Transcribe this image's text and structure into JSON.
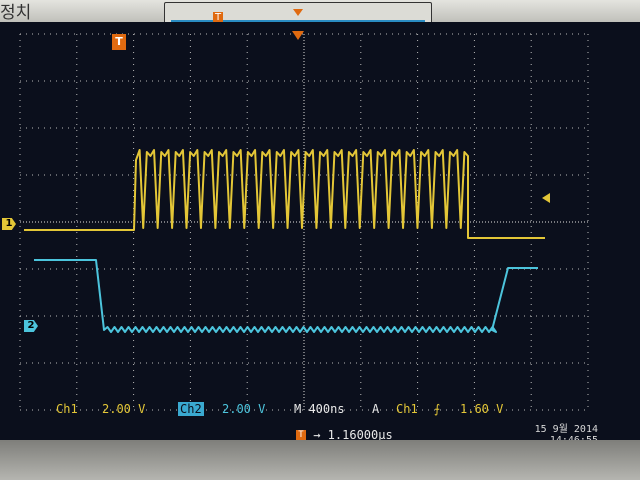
{
  "bezel": {
    "corner_text": "정치"
  },
  "trigger": {
    "marker_label": "T"
  },
  "channels": {
    "ch1_marker": "1",
    "ch2_marker": "2",
    "ch1_color": "#e3c637",
    "ch2_color": "#4cc4dc"
  },
  "status": {
    "ch1_label": "Ch1",
    "ch1_scale": "2.00 V",
    "ch2_label": "Ch2",
    "ch2_scale": "2.00 V",
    "timebase": "M 400ns",
    "trigger_mode": "A",
    "trigger_channel": "Ch1",
    "trigger_edge": "rising-edge-icon",
    "trigger_edge_symbol": "⨍",
    "trigger_level": "1.60 V"
  },
  "horizontal_delay": {
    "label": "T",
    "value": "→ 1.16000µs"
  },
  "datetime": {
    "date": "15 9월 2014",
    "time": "14:46:55"
  },
  "colors": {
    "background": "#0b0f1c",
    "grid": "#b9b9b9",
    "trigger_marker": "#e06a10"
  }
}
